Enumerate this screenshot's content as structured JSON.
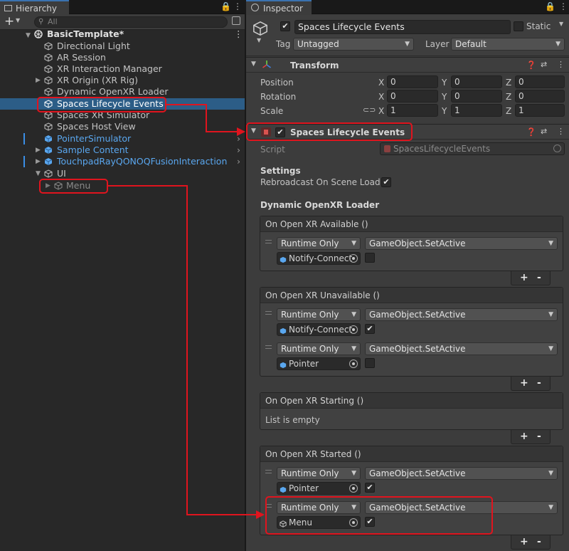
{
  "hierarchy": {
    "tab_label": "Hierarchy",
    "add_label": "+",
    "search_placeholder": "All",
    "scene_name": "BasicTemplate*",
    "items": [
      {
        "label": "Directional Light"
      },
      {
        "label": "AR Session"
      },
      {
        "label": "XR Interaction Manager"
      },
      {
        "label": "XR Origin (XR Rig)"
      },
      {
        "label": "Dynamic OpenXR Loader"
      },
      {
        "label": "Spaces Lifecycle Events"
      },
      {
        "label": "Spaces XR Simulator"
      },
      {
        "label": "Spaces Host View"
      },
      {
        "label": "PointerSimulator"
      },
      {
        "label": "Sample Content"
      },
      {
        "label": "TouchpadRayQONOQFusionInteraction"
      },
      {
        "label": "UI"
      },
      {
        "label": "Menu"
      }
    ]
  },
  "inspector": {
    "tab_label": "Inspector",
    "object_name": "Spaces Lifecycle Events",
    "static_label": "Static",
    "tag_label": "Tag",
    "tag_value": "Untagged",
    "layer_label": "Layer",
    "layer_value": "Default",
    "transform": {
      "title": "Transform",
      "position_label": "Position",
      "rotation_label": "Rotation",
      "scale_label": "Scale",
      "axis_x": "X",
      "axis_y": "Y",
      "axis_z": "Z",
      "position": [
        "0",
        "0",
        "0"
      ],
      "rotation": [
        "0",
        "0",
        "0"
      ],
      "scale": [
        "1",
        "1",
        "1"
      ]
    },
    "component": {
      "title": "Spaces Lifecycle Events",
      "script_label": "Script",
      "script_value": "SpacesLifecycleEvents",
      "settings_label": "Settings",
      "rebroadcast_label": "Rebroadcast On Scene Load",
      "loader_label": "Dynamic OpenXR Loader",
      "runtime_only": "Runtime Only",
      "set_active": "GameObject.SetActive",
      "plus": "+",
      "minus": "-",
      "events": [
        {
          "title": "On Open XR Available ()",
          "targets": [
            "Notify-Connect"
          ]
        },
        {
          "title": "On Open XR Unavailable ()",
          "targets": [
            "Notify-Connect",
            "Pointer"
          ]
        },
        {
          "title": "On Open XR Starting ()",
          "empty_text": "List is empty"
        },
        {
          "title": "On Open XR Started ()",
          "targets": [
            "Pointer",
            "Menu"
          ]
        }
      ]
    }
  },
  "colors": {
    "selection": "#2c5d87",
    "prefab_blue": "#5aa7ef",
    "annotation_red": "#e0141e"
  }
}
